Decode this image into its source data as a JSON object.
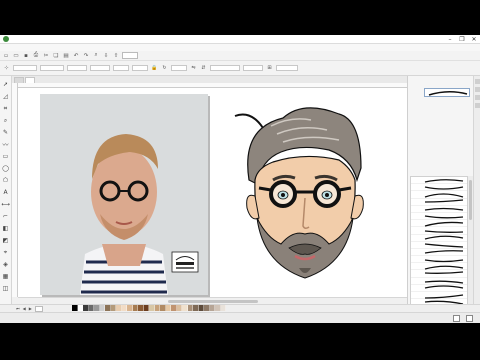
{
  "window": {
    "title": "",
    "controls": [
      "–",
      "❐",
      "✕"
    ]
  },
  "menu": {
    "items": [
      "",
      "",
      "",
      "",
      "",
      "",
      "",
      "",
      "",
      "",
      "",
      ""
    ]
  },
  "toolbar": {
    "icons": [
      "new-icon",
      "open-icon",
      "save-icon",
      "print-icon",
      "cut-icon",
      "copy-icon",
      "paste-icon",
      "undo-icon",
      "redo-icon",
      "search-icon",
      "import-icon",
      "export-icon"
    ],
    "zoom": ""
  },
  "property_bar": {
    "x": "",
    "y": "",
    "w": "",
    "h": "",
    "angle": "",
    "scale_w": "",
    "scale_h": "",
    "outline_width": "",
    "line_style": "",
    "smoothing": ""
  },
  "tabs": [
    {
      "label": "",
      "active": false
    },
    {
      "label": "",
      "active": true
    }
  ],
  "docker": {
    "title": "",
    "preview_label": "",
    "list_title": "",
    "item_label": ""
  },
  "page_bar": {
    "page_label": ""
  },
  "palette": [
    "#000000",
    "#ffffff",
    "#3b3b3b",
    "#6b6b6b",
    "#9a9a9a",
    "#cfcfcf",
    "#8c7357",
    "#b39a7a",
    "#e8cdb0",
    "#f2dcc6",
    "#d9b48f",
    "#a67c52",
    "#8a5a34",
    "#6b3d1f",
    "#d8c7a6",
    "#c7a27b",
    "#b08a63",
    "#e6c9a6",
    "#c09370",
    "#dbbfa0",
    "#f0e1ce",
    "#a99078",
    "#7f6a56",
    "#5d4b3b",
    "#8e7a68",
    "#b6a596",
    "#d1c4b8",
    "#e9e2da"
  ],
  "status": {
    "coords": "",
    "fill_label": "",
    "outline_label": ""
  }
}
